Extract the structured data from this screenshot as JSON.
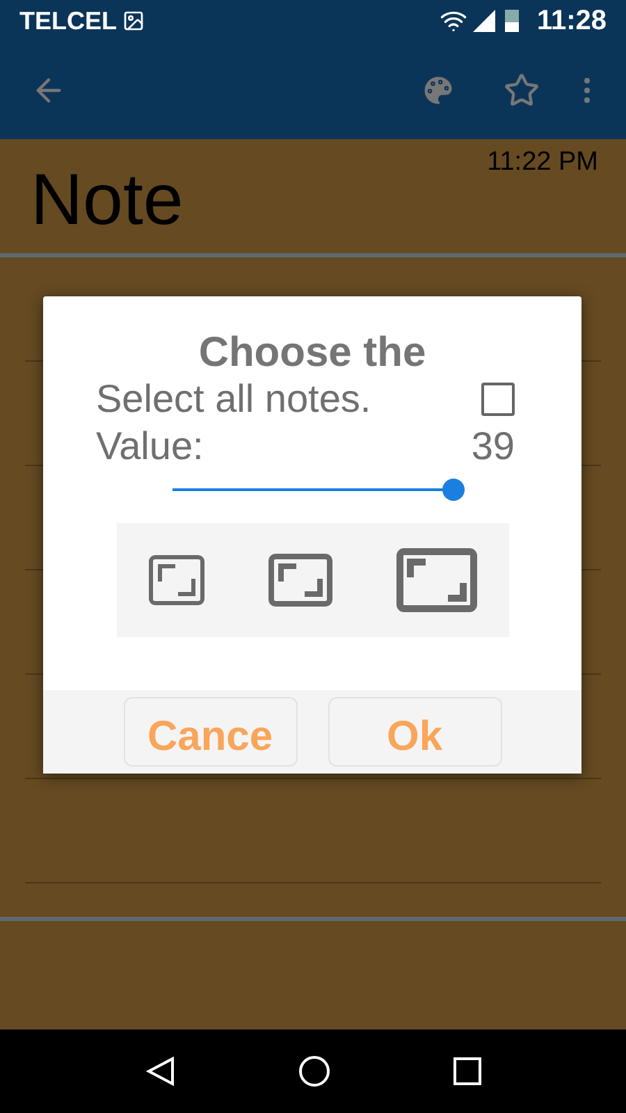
{
  "status_bar": {
    "carrier": "TELCEL",
    "time": "11:28"
  },
  "note": {
    "title": "Note",
    "time": "11:22 PM"
  },
  "dialog": {
    "title": "Choose the",
    "select_all": {
      "label": "Select all notes.",
      "checked": false
    },
    "value": {
      "label": "Value:",
      "reading": "39",
      "level": 1
    },
    "sizes": [
      {
        "kind": "small"
      },
      {
        "kind": "medium"
      },
      {
        "kind": "large"
      }
    ],
    "buttons": [
      "Cance",
      "Ok"
    ]
  }
}
